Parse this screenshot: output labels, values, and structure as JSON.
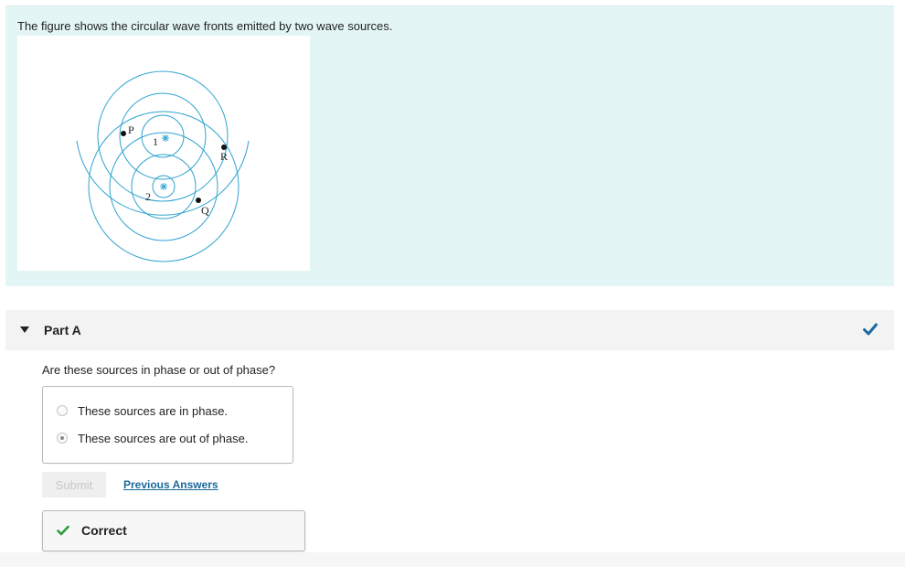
{
  "intro": {
    "text": "The figure shows the circular wave fronts emitted by two wave sources."
  },
  "figure": {
    "wave_color": "#2fa3d0",
    "labels": {
      "point_p": "P",
      "point_q": "Q",
      "point_r": "R",
      "source_1": "1",
      "source_2": "2"
    }
  },
  "part": {
    "title": "Part A",
    "status": "correct",
    "check_icon": "check-icon",
    "check_color": "#1a6a9a"
  },
  "question": {
    "prompt": "Are these sources in phase or out of phase?",
    "options": [
      {
        "label": "These sources are in phase.",
        "selected": false
      },
      {
        "label": "These sources are out of phase.",
        "selected": true
      }
    ]
  },
  "actions": {
    "submit_label": "Submit",
    "previous_answers_label": "Previous Answers"
  },
  "feedback": {
    "label": "Correct",
    "icon": "check-icon",
    "color": "#2e9b3a"
  }
}
